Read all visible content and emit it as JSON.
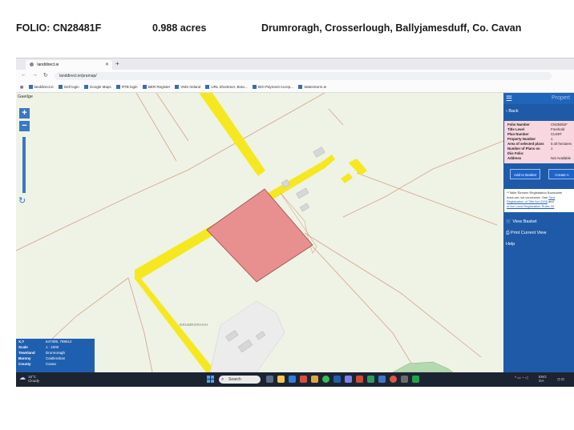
{
  "header": {
    "folio": "FOLIO: CN28481F",
    "acres": "0.988 acres",
    "address": "Drumroragh, Crosserlough, Ballyjamesduff, Co. Cavan"
  },
  "browser": {
    "tab_title": "landdirect.ie",
    "url": "landdirect.ie/pramap/",
    "bookmarks": [
      "landdirect.ie",
      "Dell login",
      "Google Maps",
      "RTB login",
      "BER Register",
      "VMS Ireland",
      "URL Shortener, Bran...",
      "BOI Payment Accep...",
      "Waterstorm.ie"
    ]
  },
  "map": {
    "language_link": "Gaeilge",
    "zoom_in": "+",
    "zoom_out": "−",
    "townland_label": "DRUMRORAGH",
    "info": [
      {
        "key": "X,Y",
        "value": "647306, 789512"
      },
      {
        "key": "Scale",
        "value": "1 : 1000"
      },
      {
        "key": "Townland",
        "value": "Drumroragh"
      },
      {
        "key": "Barony",
        "value": "Castlerahan"
      },
      {
        "key": "County",
        "value": "Cavan"
      }
    ],
    "colors": {
      "parcel": "#e88f8f",
      "road": "#f6e820",
      "background": "#eef3e5",
      "boundary": "#d9a08c"
    }
  },
  "panel": {
    "title": "Propert",
    "back": "Back",
    "details": [
      {
        "key": "Folio Number",
        "value": "CN28481F"
      },
      {
        "key": "Title Level",
        "value": "Freehold"
      },
      {
        "key": "Plan Number",
        "value": "CU49T"
      },
      {
        "key": "Property Number",
        "value": "1"
      },
      {
        "key": "Area of selected plans",
        "value": "0.40 hectares"
      },
      {
        "key": "Number of Plans on",
        "value": "1"
      },
      {
        "key": "this Folio:",
        "value": ""
      },
      {
        "key": "Address",
        "value": "Not Available"
      }
    ],
    "add_to_basket": "Add to Basket",
    "create": "Create A",
    "note_text1": "**Tailte Éireann Registration Boundarie",
    "note_text2": "Area are not conclusive. See",
    "note_link1": "Sect",
    "note_link2": "Registration of Title Act 2006",
    "note_text3": "and",
    "note_link3": "of the Land Registration Rules 20",
    "view_basket": "View Basket",
    "print_view": "Print Current View",
    "help": "Help"
  },
  "taskbar": {
    "temperature": "16°C",
    "weather": "Cloudy",
    "search_placeholder": "Search",
    "lang": "ENG",
    "region": "GA"
  }
}
